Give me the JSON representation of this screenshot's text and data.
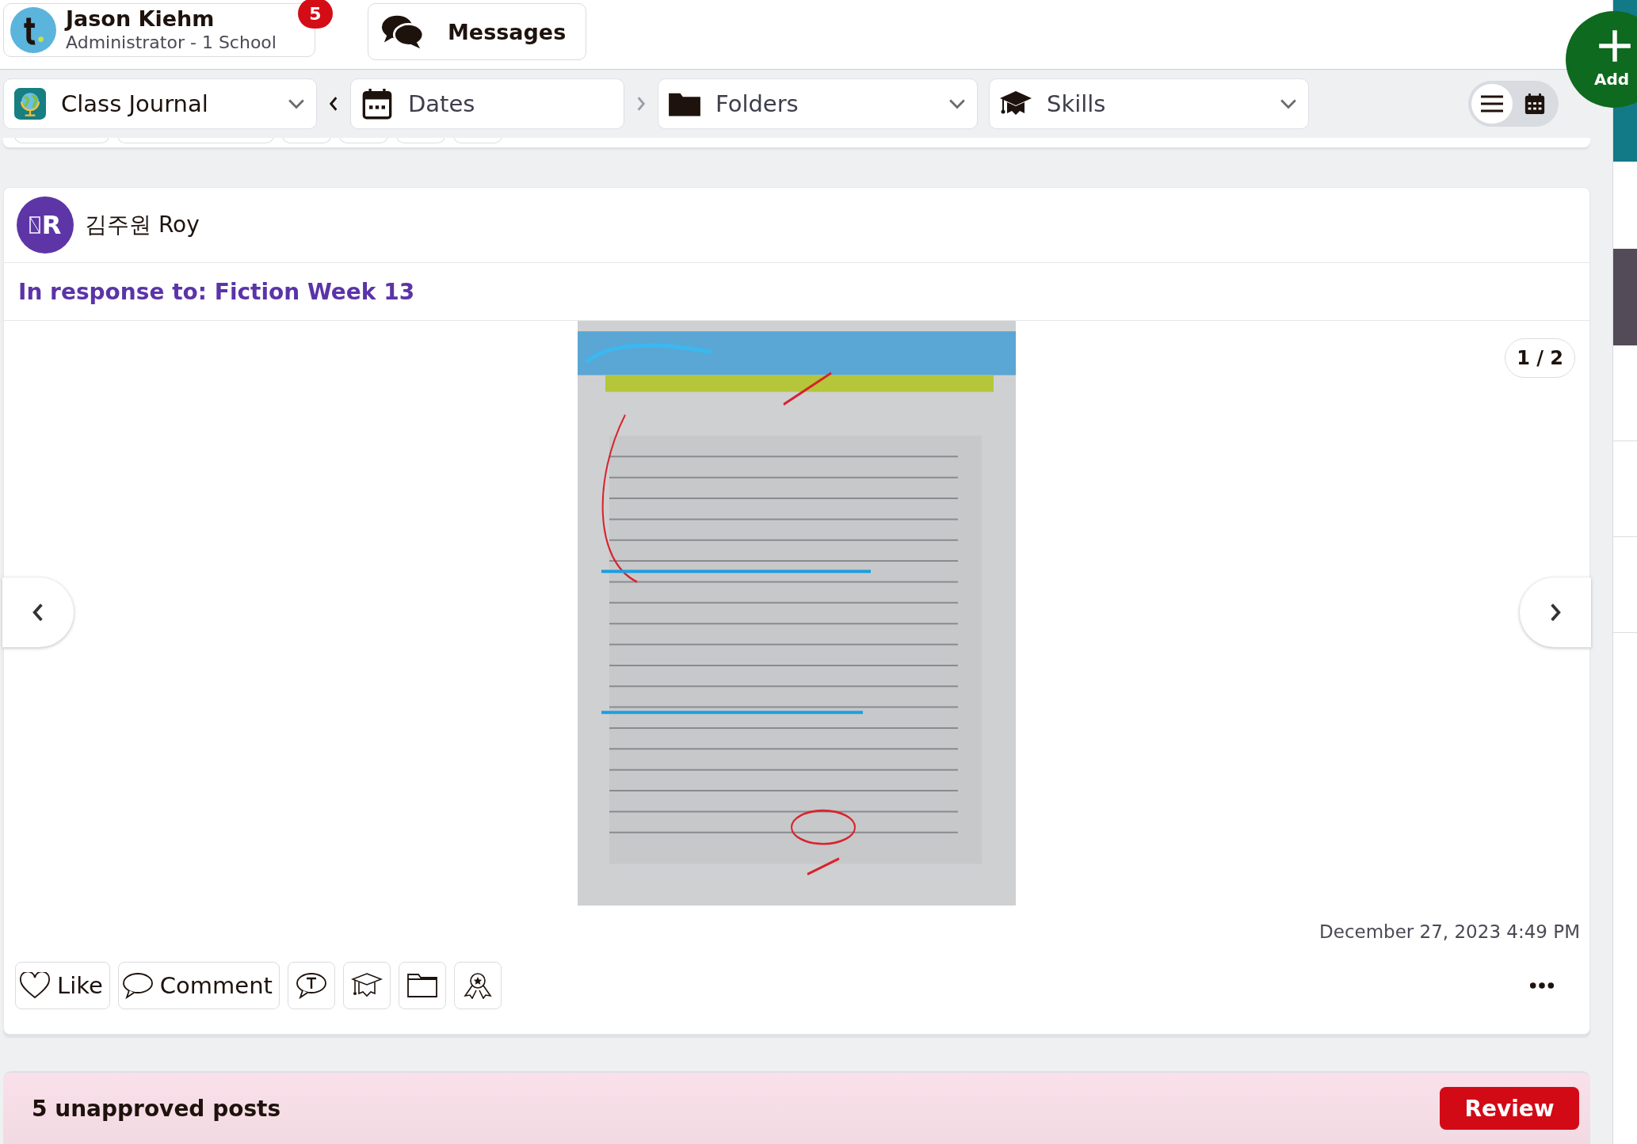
{
  "user": {
    "name": "Jason Kiehm",
    "role": "Administrator - 1 School",
    "notification_count": "5"
  },
  "messages_button": {
    "label": "Messages"
  },
  "add_button": {
    "label": "Add"
  },
  "filters": [
    {
      "kind": "journal",
      "label": "Class Journal"
    },
    {
      "kind": "dates",
      "label": "Dates"
    },
    {
      "kind": "folders",
      "label": "Folders"
    },
    {
      "kind": "skills",
      "label": "Skills"
    }
  ],
  "view_toggle": [
    {
      "kind": "list",
      "selected": true
    },
    {
      "kind": "calendar",
      "selected": false
    }
  ],
  "post": {
    "author": {
      "initials": "R",
      "name": "김주원 Roy"
    },
    "response_to": "In response to: Fiction Week 13",
    "image": {
      "kind": "picture",
      "counter": "1 / 2"
    },
    "timestamp": "December 27, 2023 4:49 PM",
    "actions": [
      {
        "kind": "like",
        "label": "Like"
      },
      {
        "kind": "comment",
        "label": "Comment"
      },
      {
        "kind": "translate"
      },
      {
        "kind": "skills"
      },
      {
        "kind": "folder"
      },
      {
        "kind": "award"
      }
    ]
  },
  "unapproved": {
    "text": "5 unapproved posts",
    "button": "Review"
  }
}
